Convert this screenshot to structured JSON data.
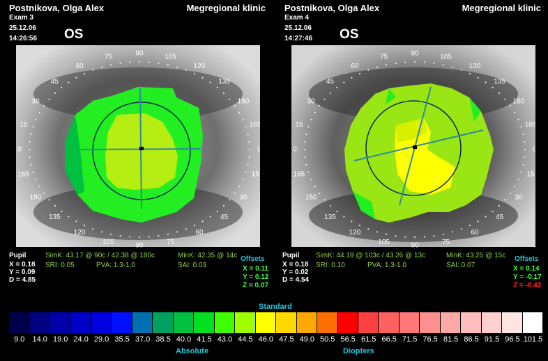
{
  "clinic": "Megregional klinic",
  "patient": "Postnikova, Olga Alex",
  "exams": [
    {
      "exam": "Exam 3",
      "date": "25.12.06",
      "time": "14:26:56",
      "eye": "OS",
      "pupil_label": "Pupil",
      "pupil_x": "X = 0.18",
      "pupil_y": "Y = 0.09",
      "pupil_d": "D = 4.85",
      "simk": "SimK: 43.17 @ 90c / 42.38 @ 180c",
      "mink": "MinK: 42.35 @ 14c",
      "sri": "SRI: 0.05",
      "pva": "PVA: 1.3-1.0",
      "sai": "SAI: 0.03",
      "offsets_label": "Offsets",
      "off_x": "X = 0.11",
      "off_y": "Y = 0.12",
      "off_z": "Z = 0.07",
      "z_color": "#3cff3c"
    },
    {
      "exam": "Exam 4",
      "date": "25.12.06",
      "time": "14:27:46",
      "eye": "OS",
      "pupil_label": "Pupil",
      "pupil_x": "X = 0.18",
      "pupil_y": "Y = 0.02",
      "pupil_d": "D = 4.54",
      "simk": "SimK: 44.19 @ 103c / 43.26 @ 13c",
      "mink": "MinK: 43.25 @ 15c",
      "sri": "SRI: 0.10",
      "pva": "PVA: 1.3-1.0",
      "sai": "SAI: 0.07",
      "offsets_label": "Offsets",
      "off_x": "X = 0.14",
      "off_y": "Y = -0.17",
      "off_z": "Z = -0.42",
      "z_color": "#ff2a2a"
    }
  ],
  "axis_degrees": [
    "0",
    "15",
    "30",
    "45",
    "60",
    "75",
    "90",
    "105",
    "120",
    "135",
    "150",
    "165",
    "0",
    "15",
    "30",
    "45",
    "60",
    "75",
    "90",
    "105",
    "120",
    "135",
    "150",
    "165"
  ],
  "scale": {
    "title": "Standard",
    "left_label": "Absolute",
    "right_label": "Diopters",
    "values": [
      "9.0",
      "14.0",
      "19.0",
      "24.0",
      "29.0",
      "35.5",
      "37.0",
      "38.5",
      "40.0",
      "41.5",
      "43.0",
      "44.5",
      "46.0",
      "47.5",
      "49.0",
      "50.5",
      "56.5",
      "61.5",
      "66.5",
      "71.5",
      "76.5",
      "81.5",
      "86.5",
      "91.5",
      "96.5",
      "101.5"
    ],
    "colors": [
      "#00004a",
      "#000080",
      "#0000a8",
      "#0000c8",
      "#0000e0",
      "#0010ff",
      "#0070b0",
      "#00a060",
      "#00c040",
      "#00e020",
      "#40ff00",
      "#a0ff00",
      "#ffff00",
      "#ffd800",
      "#ffa800",
      "#ff7000",
      "#ff0000",
      "#ff4040",
      "#ff6060",
      "#ff7878",
      "#ff9090",
      "#ffa8a8",
      "#ffbcbc",
      "#ffd0d0",
      "#ffe4e4",
      "#ffffff"
    ]
  }
}
